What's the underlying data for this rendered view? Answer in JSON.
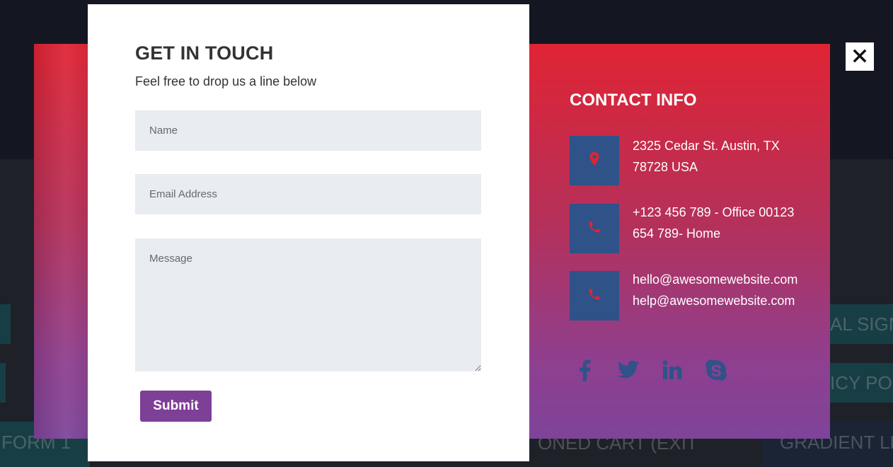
{
  "background": {
    "tiles": [
      "FORM 1",
      "ONED CART (EXIT",
      "GRADIENT LE",
      "AL SIGNU",
      "ICY POL"
    ]
  },
  "form": {
    "title": "GET IN TOUCH",
    "subtitle": "Feel free to drop us a line below",
    "name_placeholder": "Name",
    "email_placeholder": "Email Address",
    "message_placeholder": "Message",
    "submit_label": "Submit"
  },
  "contact": {
    "title": "CONTACT INFO",
    "address": [
      "2325 Cedar St. Austin, TX",
      "78728 USA"
    ],
    "phone": [
      "+123 456 789 - Office 00123",
      "654 789- Home"
    ],
    "email": [
      "hello@awesomewebsite.com",
      "help@awesomewebsite.com"
    ],
    "icons": [
      "map-pin-icon",
      "phone-icon",
      "phone-icon"
    ]
  },
  "socials": [
    "facebook-icon",
    "twitter-icon",
    "linkedin-icon",
    "skype-icon"
  ],
  "close_icon": "close-icon",
  "colors": {
    "accent": "#7e3f97",
    "icon_box": "#2f5289",
    "icon_red": "#e02434",
    "social_blue": "#2f5289",
    "gradient_top": "#e02434",
    "gradient_bottom": "#7e449a"
  }
}
